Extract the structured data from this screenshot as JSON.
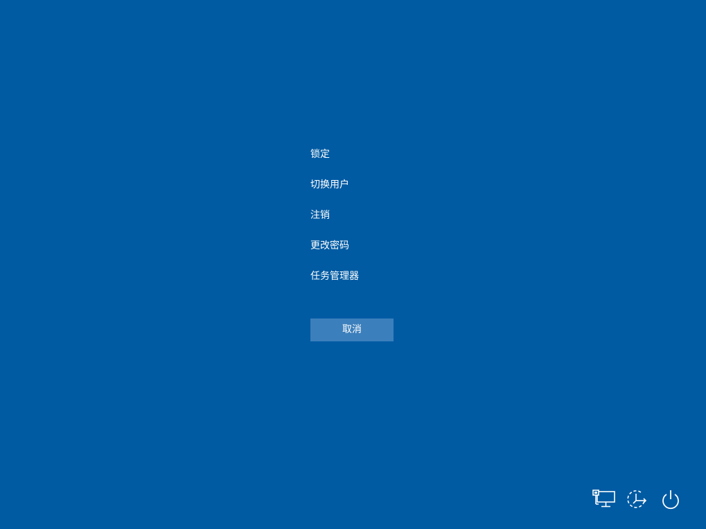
{
  "menu": {
    "items": [
      {
        "label": "锁定"
      },
      {
        "label": "切换用户"
      },
      {
        "label": "注销"
      },
      {
        "label": "更改密码"
      },
      {
        "label": "任务管理器"
      }
    ]
  },
  "cancel_label": "取消",
  "tray": {
    "icons": [
      "network-icon",
      "accessibility-icon",
      "power-icon"
    ]
  },
  "colors": {
    "background": "#005ba3",
    "button": "#3b7fbc",
    "text": "#ffffff"
  }
}
